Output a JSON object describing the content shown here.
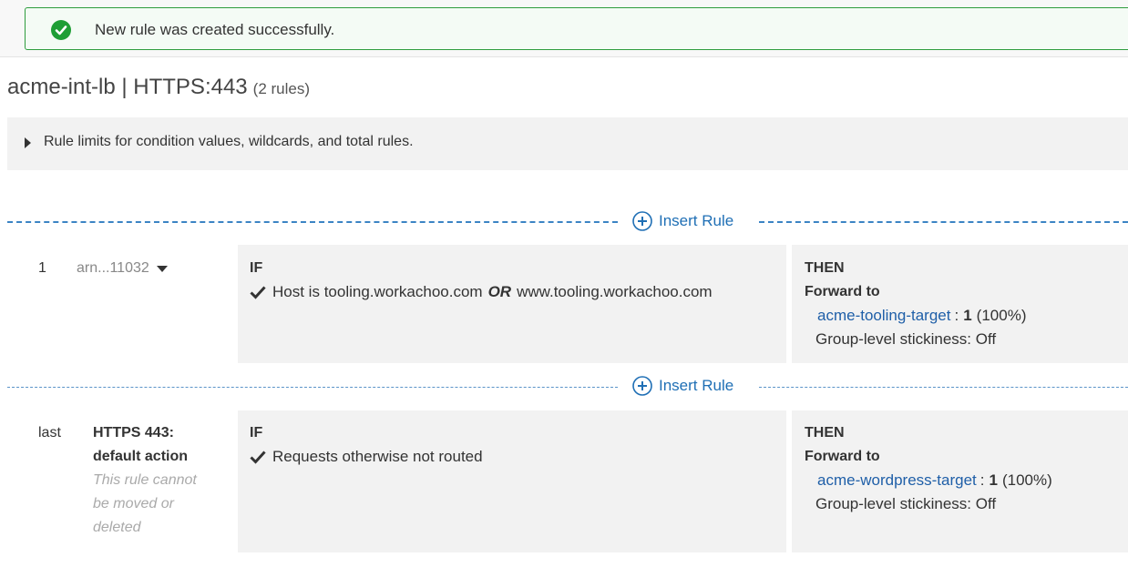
{
  "flash": {
    "message": "New rule was created successfully.",
    "icon": "check-circle-icon",
    "color": "#1e9e35"
  },
  "header": {
    "title": "acme-int-lb | HTTPS:443",
    "rule_count": "(2 rules)"
  },
  "limits": {
    "label": "Rule limits for condition values, wildcards, and total rules."
  },
  "insert_rule_label": "Insert Rule",
  "rules": [
    {
      "number": "1",
      "arn": "arn...11032",
      "if_label": "IF",
      "condition_prefix": "Host is",
      "condition_value_1": "tooling.workachoo.com",
      "condition_or": "OR",
      "condition_value_2": "www.tooling.workachoo.com",
      "then_label": "THEN",
      "action": "Forward to",
      "target": "acme-tooling-target",
      "weight": "1",
      "percent": "(100%)",
      "stickiness": "Group-level stickiness: Off"
    },
    {
      "number": "last",
      "name_line1": "HTTPS 443:",
      "name_line2": "default action",
      "note_line1": "This rule cannot",
      "note_line2": "be moved or",
      "note_line3": "deleted",
      "if_label": "IF",
      "condition": "Requests otherwise not routed",
      "then_label": "THEN",
      "action": "Forward to",
      "target": "acme-wordpress-target",
      "weight": "1",
      "percent": "(100%)",
      "stickiness": "Group-level stickiness: Off"
    }
  ],
  "colors": {
    "accent": "#1f6fb5",
    "panel": "#f2f2f2",
    "success": "#2e9c3e"
  }
}
